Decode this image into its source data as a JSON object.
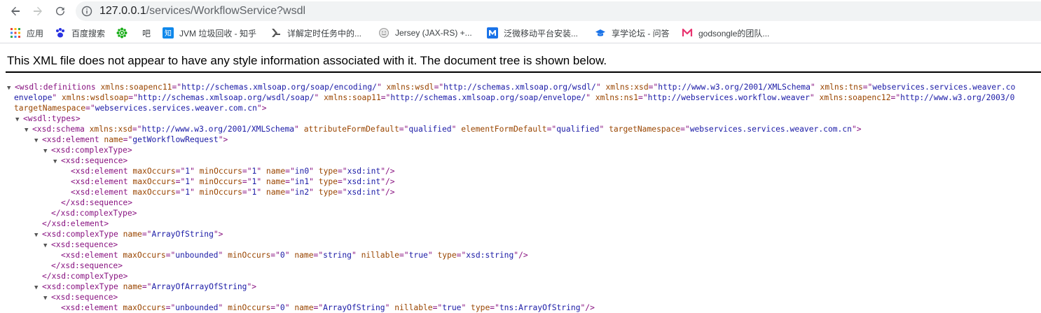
{
  "browser": {
    "url_host": "127.0.0.1",
    "url_path": "/services/WorkflowService?wsdl"
  },
  "bookmarks": [
    {
      "label": "应用",
      "icon": "apps-grid-icon"
    },
    {
      "label": "百度搜索",
      "icon": "baidu-paw-icon"
    },
    {
      "label": "",
      "icon": "gear-flower-icon"
    },
    {
      "label": "吧",
      "icon": "tieba-icon"
    },
    {
      "label": "JVM 垃圾回收 - 知乎",
      "icon": "zhihu-icon"
    },
    {
      "label": "详解定时任务中的...",
      "icon": "csdn-icon"
    },
    {
      "label": "Jersey (JAX-RS) +...",
      "icon": "globe-icon"
    },
    {
      "label": "泛微移动平台安装...",
      "icon": "m-icon"
    },
    {
      "label": "享学论坛 - 问答",
      "icon": "grad-cap-icon"
    },
    {
      "label": "godsongle的团队...",
      "icon": "m-logo-icon"
    }
  ],
  "notice": "This XML file does not appear to have any style information associated with it. The document tree is shown below.",
  "xml_lines": [
    {
      "tw": "▼",
      "p": [
        [
          "t",
          "<wsdl:definitions "
        ],
        [
          "n",
          "xmlns:soapenc11"
        ],
        [
          "t",
          "=\""
        ],
        [
          "v",
          "http://schemas.xmlsoap.org/soap/encoding/"
        ],
        [
          "t",
          "\" "
        ],
        [
          "n",
          "xmlns:wsdl"
        ],
        [
          "t",
          "=\""
        ],
        [
          "v",
          "http://schemas.xmlsoap.org/wsdl/"
        ],
        [
          "t",
          "\" "
        ],
        [
          "n",
          "xmlns:xsd"
        ],
        [
          "t",
          "=\""
        ],
        [
          "v",
          "http://www.w3.org/2001/XMLSchema"
        ],
        [
          "t",
          "\" "
        ],
        [
          "n",
          "xmlns:tns"
        ],
        [
          "t",
          "=\""
        ],
        [
          "v",
          "webservices.services.weaver.co"
        ]
      ]
    },
    {
      "tw": "",
      "p": [
        [
          "v",
          "envelope"
        ],
        [
          "t",
          "\" "
        ],
        [
          "n",
          "xmlns:wsdlsoap"
        ],
        [
          "t",
          "=\""
        ],
        [
          "v",
          "http://schemas.xmlsoap.org/wsdl/soap/"
        ],
        [
          "t",
          "\" "
        ],
        [
          "n",
          "xmlns:soap11"
        ],
        [
          "t",
          "=\""
        ],
        [
          "v",
          "http://schemas.xmlsoap.org/soap/envelope/"
        ],
        [
          "t",
          "\" "
        ],
        [
          "n",
          "xmlns:ns1"
        ],
        [
          "t",
          "=\""
        ],
        [
          "v",
          "http://webservices.workflow.weaver"
        ],
        [
          "t",
          "\" "
        ],
        [
          "n",
          "xmlns:soapenc12"
        ],
        [
          "t",
          "=\""
        ],
        [
          "v",
          "http://www.w3.org/2003/0"
        ]
      ]
    },
    {
      "tw": "",
      "p": [
        [
          "n",
          "targetNamespace"
        ],
        [
          "t",
          "=\""
        ],
        [
          "v",
          "webservices.services.weaver.com.cn"
        ],
        [
          "t",
          "\">"
        ]
      ]
    },
    {
      "tw": "▼",
      "p": [
        [
          "t",
          "<wsdl:types>"
        ]
      ]
    },
    {
      "tw": "▼",
      "p": [
        [
          "t",
          "<xsd:schema "
        ],
        [
          "n",
          "xmlns:xsd"
        ],
        [
          "t",
          "=\""
        ],
        [
          "v",
          "http://www.w3.org/2001/XMLSchema"
        ],
        [
          "t",
          "\" "
        ],
        [
          "n",
          "attributeFormDefault"
        ],
        [
          "t",
          "=\""
        ],
        [
          "v",
          "qualified"
        ],
        [
          "t",
          "\" "
        ],
        [
          "n",
          "elementFormDefault"
        ],
        [
          "t",
          "=\""
        ],
        [
          "v",
          "qualified"
        ],
        [
          "t",
          "\" "
        ],
        [
          "n",
          "targetNamespace"
        ],
        [
          "t",
          "=\""
        ],
        [
          "v",
          "webservices.services.weaver.com.cn"
        ],
        [
          "t",
          "\">"
        ]
      ]
    },
    {
      "tw": "▼",
      "p": [
        [
          "t",
          "<xsd:element "
        ],
        [
          "n",
          "name"
        ],
        [
          "t",
          "=\""
        ],
        [
          "v",
          "getWorkflowRequest"
        ],
        [
          "t",
          "\">"
        ]
      ]
    },
    {
      "tw": "▼",
      "p": [
        [
          "t",
          "<xsd:complexType>"
        ]
      ]
    },
    {
      "tw": "▼",
      "p": [
        [
          "t",
          "<xsd:sequence>"
        ]
      ]
    },
    {
      "tw": "",
      "p": [
        [
          "t",
          "<xsd:element "
        ],
        [
          "n",
          "maxOccurs"
        ],
        [
          "t",
          "=\""
        ],
        [
          "v",
          "1"
        ],
        [
          "t",
          "\" "
        ],
        [
          "n",
          "minOccurs"
        ],
        [
          "t",
          "=\""
        ],
        [
          "v",
          "1"
        ],
        [
          "t",
          "\" "
        ],
        [
          "n",
          "name"
        ],
        [
          "t",
          "=\""
        ],
        [
          "v",
          "in0"
        ],
        [
          "t",
          "\" "
        ],
        [
          "n",
          "type"
        ],
        [
          "t",
          "=\""
        ],
        [
          "v",
          "xsd:int"
        ],
        [
          "t",
          "\"/>"
        ]
      ]
    },
    {
      "tw": "",
      "p": [
        [
          "t",
          "<xsd:element "
        ],
        [
          "n",
          "maxOccurs"
        ],
        [
          "t",
          "=\""
        ],
        [
          "v",
          "1"
        ],
        [
          "t",
          "\" "
        ],
        [
          "n",
          "minOccurs"
        ],
        [
          "t",
          "=\""
        ],
        [
          "v",
          "1"
        ],
        [
          "t",
          "\" "
        ],
        [
          "n",
          "name"
        ],
        [
          "t",
          "=\""
        ],
        [
          "v",
          "in1"
        ],
        [
          "t",
          "\" "
        ],
        [
          "n",
          "type"
        ],
        [
          "t",
          "=\""
        ],
        [
          "v",
          "xsd:int"
        ],
        [
          "t",
          "\"/>"
        ]
      ]
    },
    {
      "tw": "",
      "p": [
        [
          "t",
          "<xsd:element "
        ],
        [
          "n",
          "maxOccurs"
        ],
        [
          "t",
          "=\""
        ],
        [
          "v",
          "1"
        ],
        [
          "t",
          "\" "
        ],
        [
          "n",
          "minOccurs"
        ],
        [
          "t",
          "=\""
        ],
        [
          "v",
          "1"
        ],
        [
          "t",
          "\" "
        ],
        [
          "n",
          "name"
        ],
        [
          "t",
          "=\""
        ],
        [
          "v",
          "in2"
        ],
        [
          "t",
          "\" "
        ],
        [
          "n",
          "type"
        ],
        [
          "t",
          "=\""
        ],
        [
          "v",
          "xsd:int"
        ],
        [
          "t",
          "\"/>"
        ]
      ]
    },
    {
      "tw": "",
      "p": [
        [
          "t",
          "</xsd:sequence>"
        ]
      ]
    },
    {
      "tw": "",
      "p": [
        [
          "t",
          "</xsd:complexType>"
        ]
      ]
    },
    {
      "tw": "",
      "p": [
        [
          "t",
          "</xsd:element>"
        ]
      ]
    },
    {
      "tw": "▼",
      "p": [
        [
          "t",
          "<xsd:complexType "
        ],
        [
          "n",
          "name"
        ],
        [
          "t",
          "=\""
        ],
        [
          "v",
          "ArrayOfString"
        ],
        [
          "t",
          "\">"
        ]
      ]
    },
    {
      "tw": "▼",
      "p": [
        [
          "t",
          "<xsd:sequence>"
        ]
      ]
    },
    {
      "tw": "",
      "p": [
        [
          "t",
          "<xsd:element "
        ],
        [
          "n",
          "maxOccurs"
        ],
        [
          "t",
          "=\""
        ],
        [
          "v",
          "unbounded"
        ],
        [
          "t",
          "\" "
        ],
        [
          "n",
          "minOccurs"
        ],
        [
          "t",
          "=\""
        ],
        [
          "v",
          "0"
        ],
        [
          "t",
          "\" "
        ],
        [
          "n",
          "name"
        ],
        [
          "t",
          "=\""
        ],
        [
          "v",
          "string"
        ],
        [
          "t",
          "\" "
        ],
        [
          "n",
          "nillable"
        ],
        [
          "t",
          "=\""
        ],
        [
          "v",
          "true"
        ],
        [
          "t",
          "\" "
        ],
        [
          "n",
          "type"
        ],
        [
          "t",
          "=\""
        ],
        [
          "v",
          "xsd:string"
        ],
        [
          "t",
          "\"/>"
        ]
      ]
    },
    {
      "tw": "",
      "p": [
        [
          "t",
          "</xsd:sequence>"
        ]
      ]
    },
    {
      "tw": "",
      "p": [
        [
          "t",
          "</xsd:complexType>"
        ]
      ]
    },
    {
      "tw": "▼",
      "p": [
        [
          "t",
          "<xsd:complexType "
        ],
        [
          "n",
          "name"
        ],
        [
          "t",
          "=\""
        ],
        [
          "v",
          "ArrayOfArrayOfString"
        ],
        [
          "t",
          "\">"
        ]
      ]
    },
    {
      "tw": "▼",
      "p": [
        [
          "t",
          "<xsd:sequence>"
        ]
      ]
    },
    {
      "tw": "",
      "p": [
        [
          "t",
          "<xsd:element "
        ],
        [
          "n",
          "maxOccurs"
        ],
        [
          "t",
          "=\""
        ],
        [
          "v",
          "unbounded"
        ],
        [
          "t",
          "\" "
        ],
        [
          "n",
          "minOccurs"
        ],
        [
          "t",
          "=\""
        ],
        [
          "v",
          "0"
        ],
        [
          "t",
          "\" "
        ],
        [
          "n",
          "name"
        ],
        [
          "t",
          "=\""
        ],
        [
          "v",
          "ArrayOfString"
        ],
        [
          "t",
          "\" "
        ],
        [
          "n",
          "nillable"
        ],
        [
          "t",
          "=\""
        ],
        [
          "v",
          "true"
        ],
        [
          "t",
          "\" "
        ],
        [
          "n",
          "type"
        ],
        [
          "t",
          "=\""
        ],
        [
          "v",
          "tns:ArrayOfString"
        ],
        [
          "t",
          "\"/>"
        ]
      ]
    }
  ]
}
